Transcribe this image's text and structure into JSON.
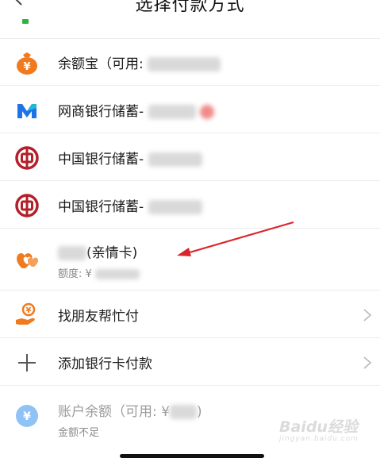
{
  "header": {
    "title": "选择付款方式"
  },
  "methods": [
    {
      "label": "余额宝（可用:",
      "icon": "yuebao-icon"
    },
    {
      "label": "网商银行储蓄-",
      "icon": "mybank-icon"
    },
    {
      "label": "中国银行储蓄-",
      "icon": "boc-icon"
    },
    {
      "label": "中国银行储蓄-",
      "icon": "boc-icon"
    },
    {
      "label": "(亲情卡)",
      "sub": "额度: ¥",
      "icon": "family-card-icon"
    },
    {
      "label": "找朋友帮忙付",
      "icon": "friend-pay-icon"
    },
    {
      "label": "添加银行卡付款",
      "icon": "plus-icon"
    },
    {
      "label": "账户余额（可用: ¥",
      "label_end": ")",
      "sub": "金额不足",
      "icon": "balance-icon"
    }
  ],
  "watermark": {
    "text": "Baidu经验",
    "sub": "jingyan.baidu.com"
  },
  "colors": {
    "orange": "#f07a1f",
    "boc_red": "#b3202a",
    "mybank_blue": "#1e73e8",
    "balance_blue": "#4a9df0",
    "annotation_red": "#d9262b"
  }
}
